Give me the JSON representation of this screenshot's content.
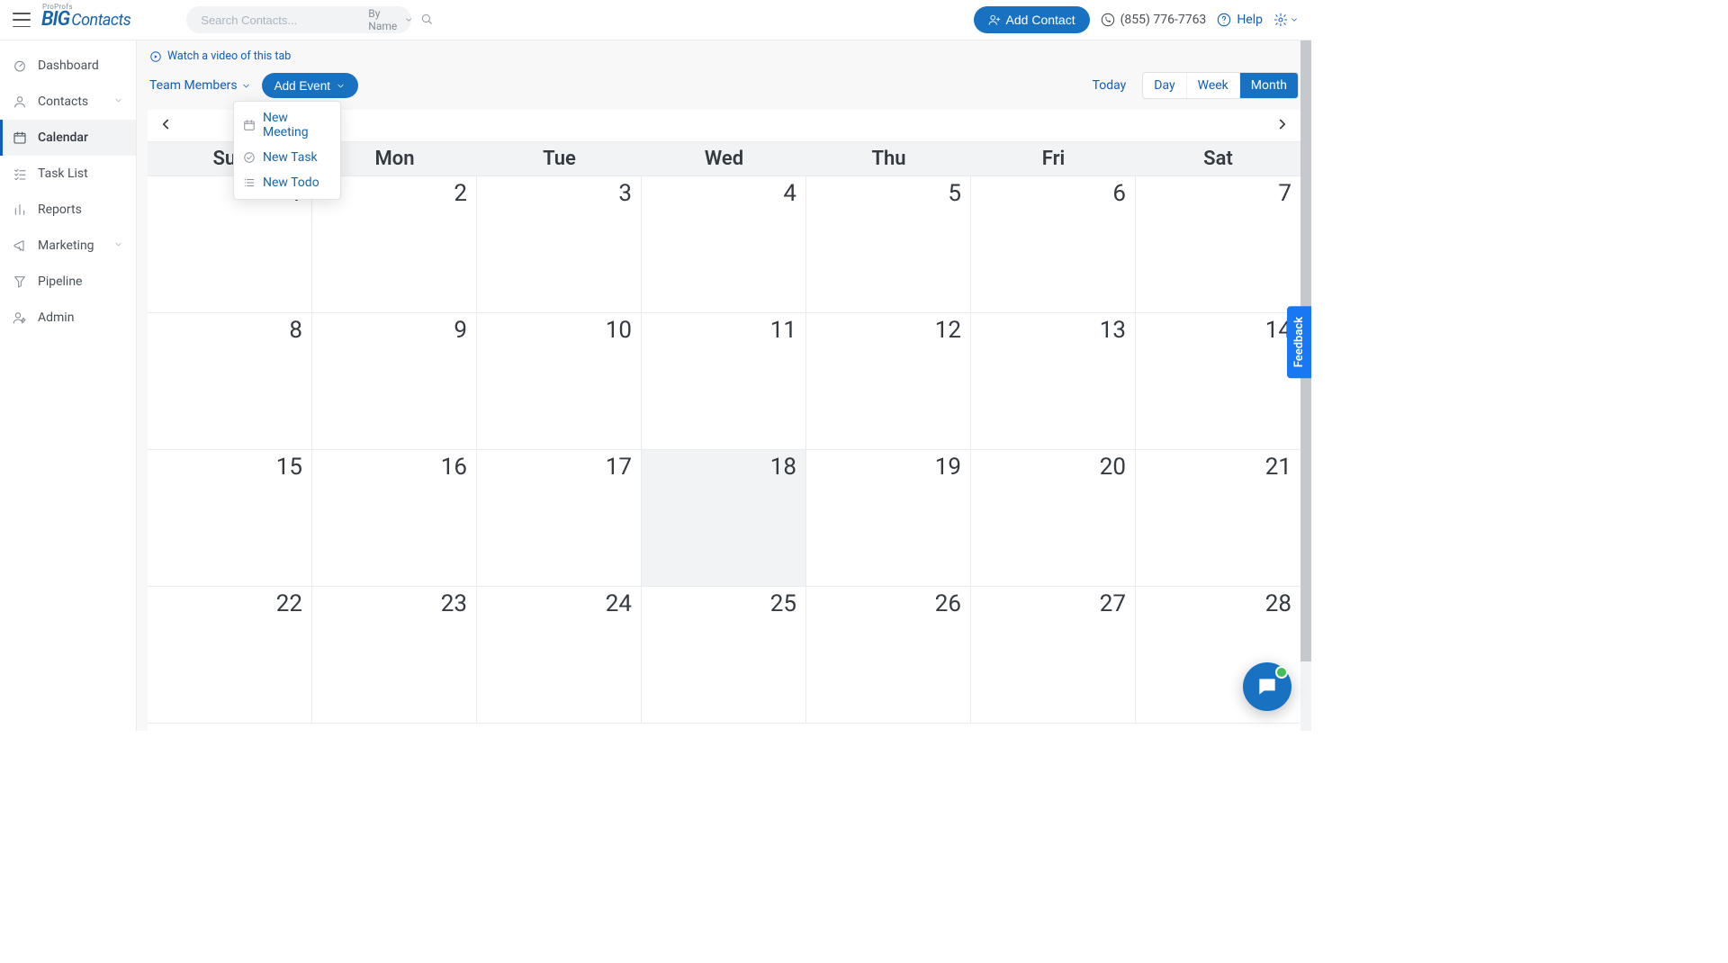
{
  "brand": {
    "proprofs": "ProProfs",
    "big": "BIG",
    "contacts": "Contacts"
  },
  "search": {
    "placeholder": "Search Contacts...",
    "filter_label": "By Name"
  },
  "topbar": {
    "add_contact": "Add Contact",
    "phone": "(855) 776-7763",
    "help": "Help"
  },
  "sidebar": {
    "items": [
      {
        "name": "dashboard",
        "label": "Dashboard",
        "expandable": false
      },
      {
        "name": "contacts",
        "label": "Contacts",
        "expandable": true
      },
      {
        "name": "calendar",
        "label": "Calendar",
        "expandable": false
      },
      {
        "name": "task-list",
        "label": "Task List",
        "expandable": false
      },
      {
        "name": "reports",
        "label": "Reports",
        "expandable": false
      },
      {
        "name": "marketing",
        "label": "Marketing",
        "expandable": true
      },
      {
        "name": "pipeline",
        "label": "Pipeline",
        "expandable": false
      },
      {
        "name": "admin",
        "label": "Admin",
        "expandable": false
      }
    ],
    "active": "calendar"
  },
  "main": {
    "watch_video_label": "Watch a video of this tab",
    "team_members_label": "Team Members",
    "add_event_label": "Add Event",
    "add_event_menu": [
      {
        "name": "new-meeting",
        "label": "New Meeting"
      },
      {
        "name": "new-task",
        "label": "New Task"
      },
      {
        "name": "new-todo",
        "label": "New Todo"
      }
    ],
    "views": {
      "today": "Today",
      "day": "Day",
      "week": "Week",
      "month": "Month",
      "active": "month"
    }
  },
  "calendar": {
    "day_headers": [
      "Sun",
      "Mon",
      "Tue",
      "Wed",
      "Thu",
      "Fri",
      "Sat"
    ],
    "days": [
      1,
      2,
      3,
      4,
      5,
      6,
      7,
      8,
      9,
      10,
      11,
      12,
      13,
      14,
      15,
      16,
      17,
      18,
      19,
      20,
      21,
      22,
      23,
      24,
      25,
      26,
      27,
      28
    ],
    "today": 18
  },
  "feedback_label": "Feedback"
}
